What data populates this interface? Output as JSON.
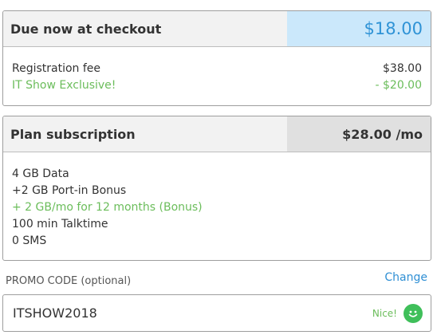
{
  "checkout": {
    "title": "Due now at checkout",
    "total": "$18.00",
    "items": [
      {
        "label": "Registration fee",
        "value": "$38.00"
      },
      {
        "label": "IT Show Exclusive!",
        "value": "- $20.00"
      }
    ]
  },
  "plan": {
    "title": "Plan subscription",
    "price": "$28.00 /mo",
    "features": [
      "4 GB Data",
      "+2 GB Port-in Bonus",
      "+ 2 GB/mo for 12 months (Bonus)",
      "100 min Talktime",
      "0 SMS"
    ]
  },
  "promo": {
    "label": "PROMO CODE (optional)",
    "change_label": "Change",
    "value": "ITSHOW2018",
    "status": "Nice!",
    "status_icon": "smiley-icon"
  },
  "colors": {
    "accent_blue": "#2f93d6",
    "success_green": "#6bbd5b",
    "checkout_bg": "#cbe8fb"
  }
}
